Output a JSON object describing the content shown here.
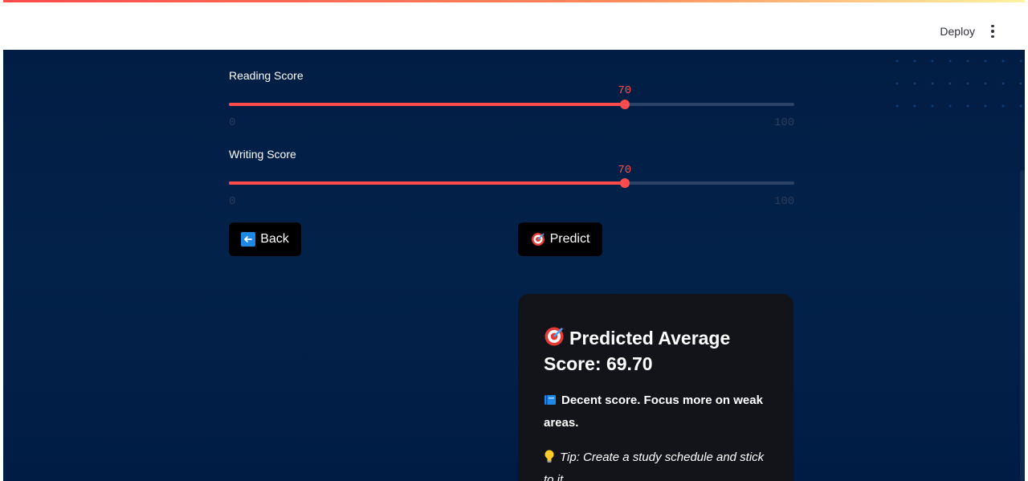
{
  "header": {
    "deploy_label": "Deploy",
    "menu_icon": "kebab-menu-icon"
  },
  "sliders": [
    {
      "label": "Reading Score",
      "value": 70,
      "value_text": "70",
      "min": 0,
      "max": 100,
      "min_text": "0",
      "max_text": "100"
    },
    {
      "label": "Writing Score",
      "value": 70,
      "value_text": "70",
      "min": 0,
      "max": 100,
      "min_text": "0",
      "max_text": "100"
    }
  ],
  "buttons": {
    "back_label": "Back",
    "back_icon": "left-arrow-icon",
    "predict_label": "Predict",
    "predict_icon": "target-icon"
  },
  "result": {
    "title": "Predicted Average Score: 69.70",
    "title_icon": "target-icon",
    "message": "Decent score. Focus more on weak areas.",
    "message_icon": "book-icon",
    "tip": "Tip: Create a study schedule and stick to it.",
    "tip_icon": "lightbulb-icon"
  },
  "colors": {
    "accent": "#ff4b4b",
    "background": "#011d44",
    "card": "#121419",
    "button": "#000000"
  }
}
